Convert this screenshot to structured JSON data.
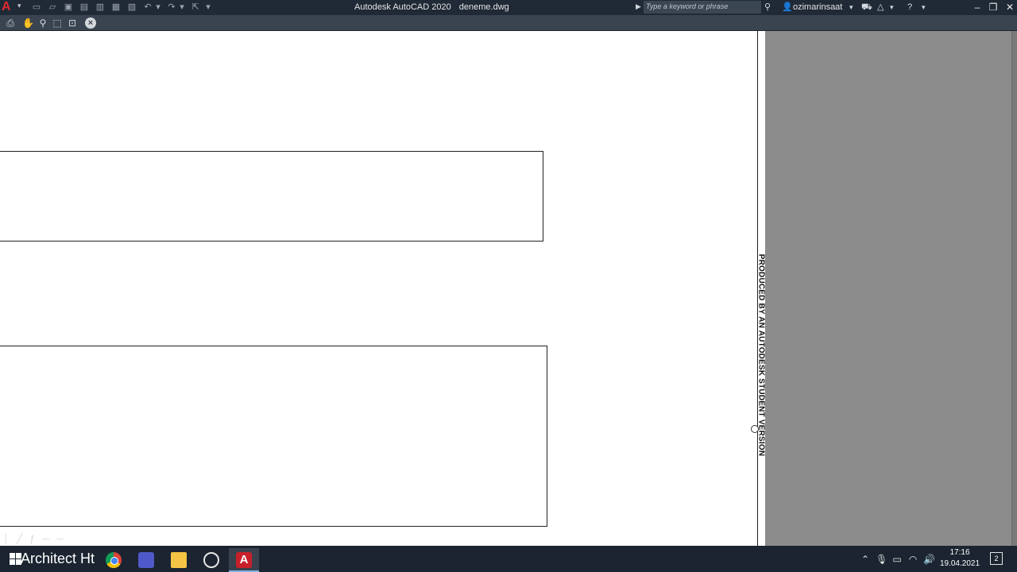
{
  "titlebar": {
    "app_name": "Autodesk AutoCAD 2020",
    "file_name": "deneme.dwg",
    "search_placeholder": "Type a keyword or phrase",
    "username": "ozimarinsaat",
    "app_logo": "A"
  },
  "quick_access": [
    "new-icon",
    "open-icon",
    "save-icon",
    "save-as-icon",
    "open-from-web-icon",
    "save-to-web-icon",
    "plot-icon",
    "undo-icon",
    "redo-icon",
    "share-icon",
    "customize-icon"
  ],
  "preview_toolbar": [
    "plot-icon",
    "pan-icon",
    "zoom-icon",
    "zoom-window-icon",
    "zoom-original-icon",
    "close-preview-icon"
  ],
  "canvas": {
    "watermark": "PRODUCED BY AN AUTODESK STUDENT VERSION",
    "faint_text": "│ ╱ ƒ ─ ─"
  },
  "taskbar": {
    "overlay_label": "Architect Ht",
    "apps": [
      "chrome-icon",
      "teams-icon",
      "file-explorer-icon",
      "obs-icon",
      "autocad-icon"
    ],
    "autocad_letter": "A",
    "time": "17:16",
    "date": "19.04.2021",
    "notification_count": "2"
  },
  "colors": {
    "titlebar": "#202a36",
    "toolbar": "#3a4451",
    "paper": "#ffffff",
    "outside_paper": "#8c8c8c",
    "taskbar": "#1b2430",
    "autocad_red": "#c8202a"
  }
}
